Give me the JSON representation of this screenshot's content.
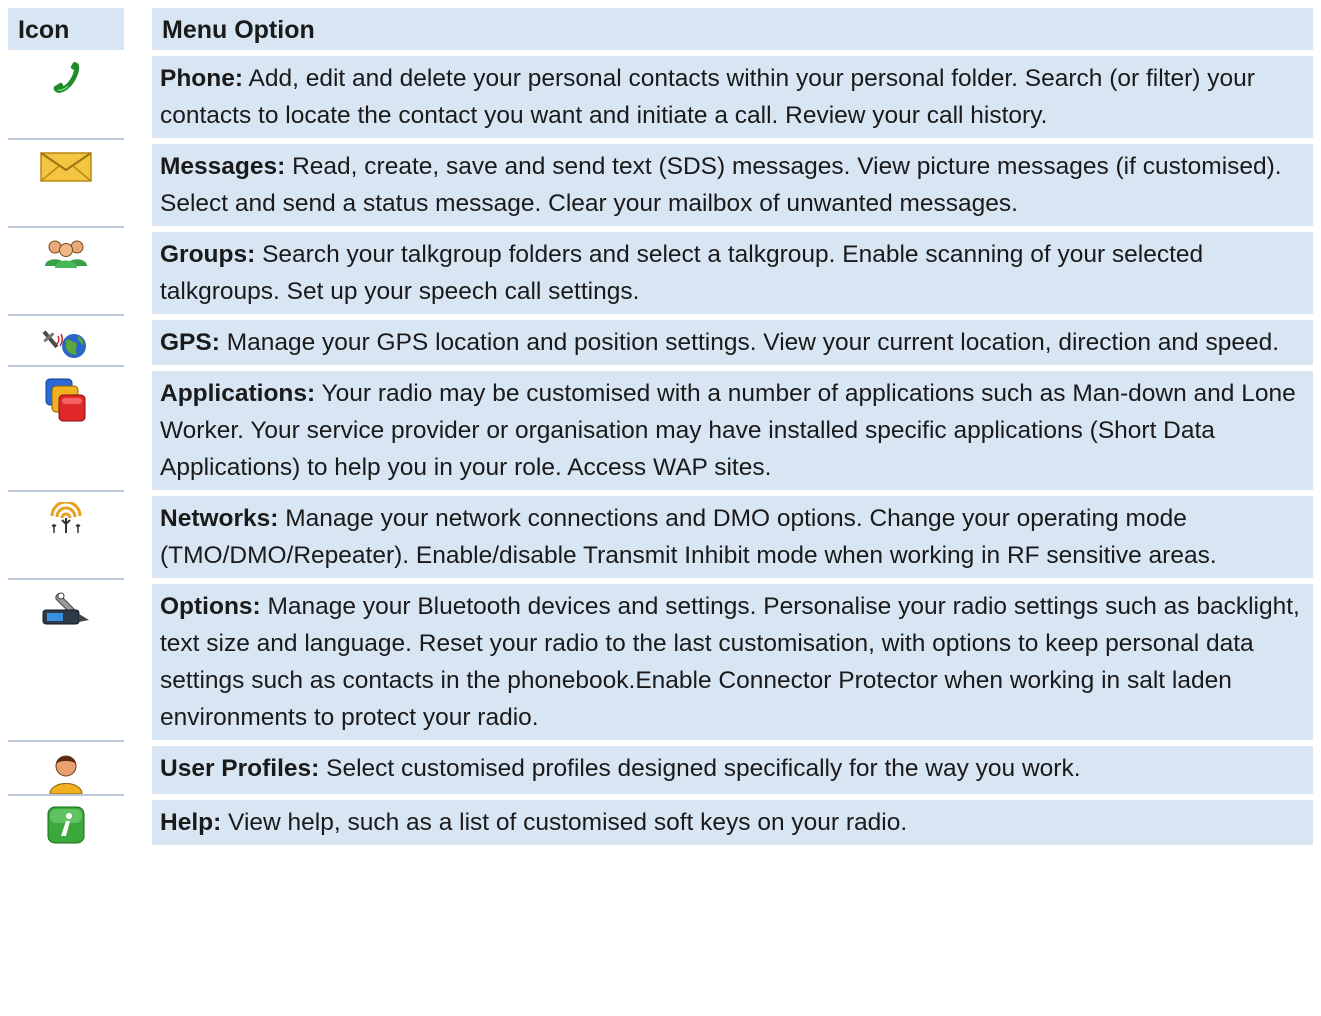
{
  "header": {
    "icon_col": "Icon",
    "option_col": "Menu Option"
  },
  "rows": [
    {
      "icon": "phone-handset-icon",
      "title": "Phone:",
      "text": " Add, edit and delete your personal contacts within your personal folder. Search (or filter) your contacts to locate the contact you want and initiate a call. Review your call history."
    },
    {
      "icon": "envelope-icon",
      "title": "Messages:",
      "text": " Read, create, save and send text (SDS) messages. View picture messages (if customised). Select and send a status message. Clear your mailbox of unwanted messages."
    },
    {
      "icon": "people-group-icon",
      "title": "Groups:",
      "text": " Search your talkgroup folders and select a talkgroup. Enable scanning of your selected talkgroups. Set up your speech call settings."
    },
    {
      "icon": "satellite-globe-icon",
      "title": "GPS:",
      "text": " Manage your GPS location and position settings. View your current location, direction and speed."
    },
    {
      "icon": "applications-squares-icon",
      "title": "Applications:",
      "text": " Your radio may be customised with a number of applications such as Man-down and Lone Worker. Your service provider or organisation may have installed specific applications (Short Data Applications) to help you in your role. Access WAP sites."
    },
    {
      "icon": "network-antenna-icon",
      "title": "Networks:",
      "text": " Manage your network connections and DMO options. Change your operating mode (TMO/DMO/Repeater). Enable/disable Transmit Inhibit mode when working in RF sensitive areas."
    },
    {
      "icon": "wrench-radio-icon",
      "title": "Options:",
      "text": " Manage your Bluetooth devices and settings. Personalise your radio settings such as backlight, text size and language. Reset your radio to the last customisation, with options to keep personal data settings such as contacts in the phonebook.Enable Connector Protector when working in salt laden environments to protect your radio."
    },
    {
      "icon": "user-profile-icon",
      "title": "User Profiles:",
      "text": " Select customised profiles designed specifically for the way you work."
    },
    {
      "icon": "help-info-icon",
      "title": "Help:",
      "text": " View help, such as a list of customised soft keys on your radio."
    }
  ]
}
